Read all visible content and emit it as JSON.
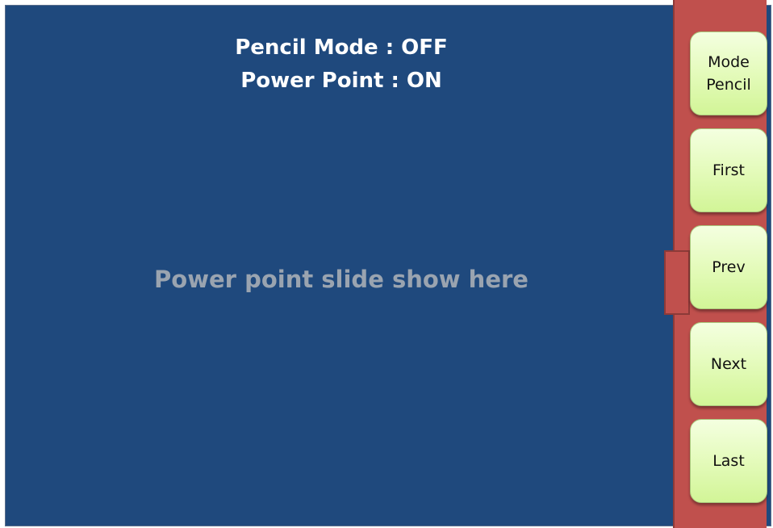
{
  "status": {
    "pencil_mode": "Pencil Mode : OFF",
    "power_point": "Power Point : ON"
  },
  "slide": {
    "placeholder": "Power point slide show here"
  },
  "controls": {
    "mode_pencil_label": "Mode\nPencil",
    "first_label": "First",
    "prev_label": "Prev",
    "next_label": "Next",
    "last_label": "Last"
  },
  "colors": {
    "slide_bg": "#1f497d",
    "panel_bg": "#c0504d",
    "button_bg": "#e4fbbb"
  }
}
